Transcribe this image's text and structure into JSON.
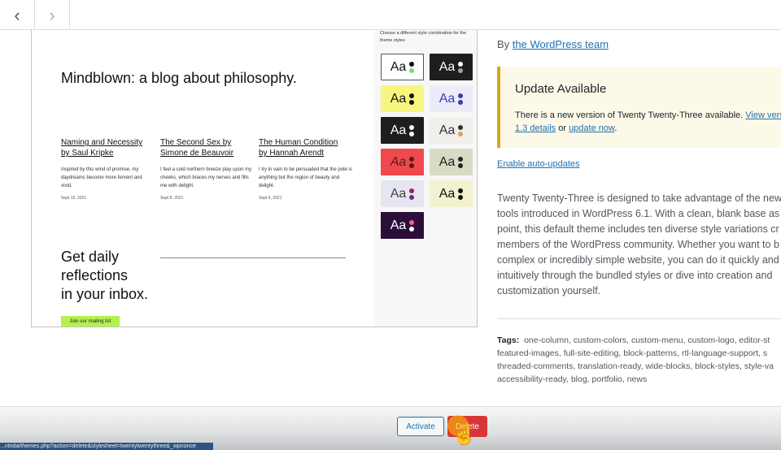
{
  "nav": {
    "prev_icon": "‹",
    "next_icon": "›"
  },
  "preview": {
    "blog_title": "Mindblown: a blog about philosophy.",
    "posts": [
      {
        "title_1": "Naming and Necessity",
        "title_2": "by Saul Kripke",
        "excerpt": "Inspired by this wind of promise, my daydreams become more fervent and vivid.",
        "date": "Sept 10, 2021"
      },
      {
        "title_1": "The Second Sex by",
        "title_2": "Simone de Beauvoir",
        "excerpt": "I feel a cold northern breeze play upon my cheeks, which braces my nerves and fills me with delight.",
        "date": "Sept 8, 2021"
      },
      {
        "title_1": "The Human Condition",
        "title_2": "by Hannah Arendt",
        "excerpt": "I try in vain to be persuaded that the pole is anything but the region of beauty and delight.",
        "date": "Sept 6, 2021"
      }
    ],
    "cta_lines": [
      "Get daily",
      "reflections",
      "in your inbox."
    ],
    "join_label": "Join our mailing list",
    "styles_caption": "Choose a different style combination for the theme styles",
    "swatches": [
      {
        "label": "Aa",
        "bg": "#ffffff",
        "fg": "#111111",
        "dot1": "#111111",
        "dot2": "#6fe070",
        "border": "#555555"
      },
      {
        "label": "Aa",
        "bg": "#1e1e1e",
        "fg": "#ffffff",
        "dot1": "#ffffff",
        "dot2": "#a8a38a",
        "border": "#1e1e1e"
      },
      {
        "label": "Aa",
        "bg": "#f7f77f",
        "fg": "#111111",
        "dot1": "#111111",
        "dot2": "#111111",
        "border": "#f7f77f"
      },
      {
        "label": "Aa",
        "bg": "#ecebf8",
        "fg": "#3b3bb3",
        "dot1": "#3b3bb3",
        "dot2": "#3b3bb3",
        "border": "#ecebf8"
      },
      {
        "label": "Aa",
        "bg": "#1e1e1e",
        "fg": "#ffffff",
        "dot1": "#ffffff",
        "dot2": "#ffffff",
        "border": "#1e1e1e"
      },
      {
        "label": "Aa",
        "bg": "#f1efeb",
        "fg": "#333333",
        "dot1": "#333333",
        "dot2": "#d9a05a",
        "border": "#f1efeb"
      },
      {
        "label": "Aa",
        "bg": "#f0494d",
        "fg": "#5a1a1a",
        "dot1": "#5a1a1a",
        "dot2": "#5a1a1a",
        "border": "#f0494d"
      },
      {
        "label": "Aa",
        "bg": "#d9dcc5",
        "fg": "#222222",
        "dot1": "#222222",
        "dot2": "#222222",
        "border": "#d9dcc5"
      },
      {
        "label": "Aa",
        "bg": "#e6e6f0",
        "fg": "#444444",
        "dot1": "#a02060",
        "dot2": "#6a2a8a",
        "border": "#e6e6f0"
      },
      {
        "label": "Aa",
        "bg": "#f3f2cf",
        "fg": "#111111",
        "dot1": "#111111",
        "dot2": "#111111",
        "border": "#f3f2cf"
      },
      {
        "label": "Aa",
        "bg": "#2b0f3a",
        "fg": "#ffffff",
        "dot1": "#ff5a9e",
        "dot2": "#ffffff",
        "border": "#2b0f3a"
      }
    ]
  },
  "details": {
    "by_prefix": "By",
    "by_link": "the WordPress team",
    "notice_title": "Update Available",
    "notice_text_1": "There is a new version of Twenty Twenty-Three available.",
    "notice_link_view": "View vers",
    "notice_link_details": "1.3 details",
    "notice_or": "or",
    "notice_link_update": "update now",
    "notice_end": ".",
    "auto_updates": "Enable auto-updates",
    "description_lines": [
      "Twenty Twenty-Three is designed to take advantage of the new",
      "tools introduced in WordPress 6.1. With a clean, blank base as a",
      "point, this default theme includes ten diverse style variations cr",
      "members of the WordPress community. Whether you want to b",
      "complex or incredibly simple website, you can do it quickly and",
      "intuitively through the bundled styles or dive into creation and",
      "customization yourself."
    ],
    "tags_label": "Tags:",
    "tags_lines": [
      "one-column, custom-colors, custom-menu, custom-logo, editor-st",
      "featured-images, full-site-editing, block-patterns, rtl-language-support, s",
      "threaded-comments, translation-ready, wide-blocks, block-styles, style-va",
      "accessibility-ready, blog, portfolio, news"
    ]
  },
  "footer": {
    "activate_label": "Activate",
    "delete_label": "Delete",
    "status_text": "...ntrida/themes.php?action=delete&stylesheet=twentytwentythree&_wpnonce"
  }
}
